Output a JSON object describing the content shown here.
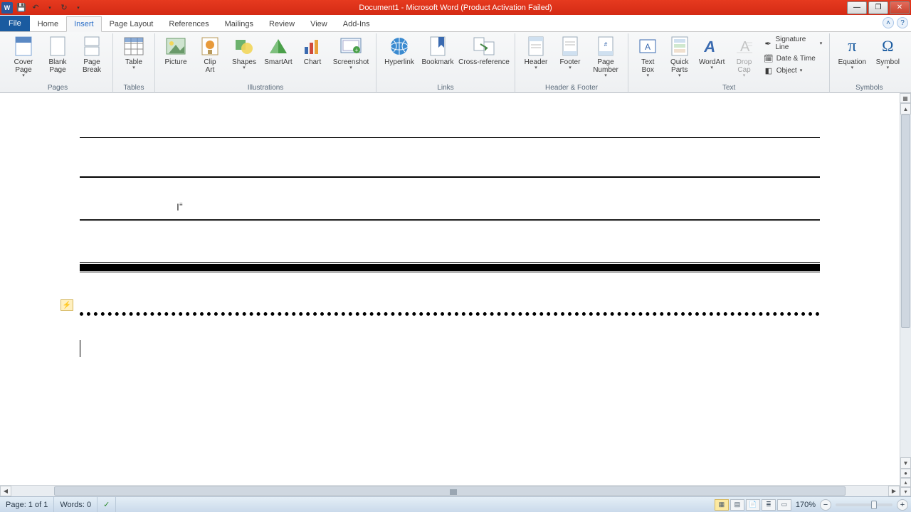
{
  "title": "Document1 - Microsoft Word (Product Activation Failed)",
  "qat": {
    "save": "💾",
    "undo": "↶",
    "redo": "↻",
    "customize": "▾"
  },
  "tabs": [
    "File",
    "Home",
    "Insert",
    "Page Layout",
    "References",
    "Mailings",
    "Review",
    "View",
    "Add-Ins"
  ],
  "active_tab": "Insert",
  "ribbon_help": {
    "minimize": "˄",
    "help": "?"
  },
  "ribbon": {
    "pages": {
      "label": "Pages",
      "cover": "Cover\nPage",
      "cover_drop": "▾",
      "blank": "Blank\nPage",
      "break": "Page\nBreak"
    },
    "tables": {
      "label": "Tables",
      "table": "Table",
      "table_drop": "▾"
    },
    "illustrations": {
      "label": "Illustrations",
      "picture": "Picture",
      "clipart": "Clip\nArt",
      "shapes": "Shapes",
      "shapes_drop": "▾",
      "smartart": "SmartArt",
      "chart": "Chart",
      "screenshot": "Screenshot",
      "screenshot_drop": "▾"
    },
    "links": {
      "label": "Links",
      "hyperlink": "Hyperlink",
      "bookmark": "Bookmark",
      "crossref": "Cross-reference"
    },
    "headerfooter": {
      "label": "Header & Footer",
      "header": "Header",
      "header_drop": "▾",
      "footer": "Footer",
      "footer_drop": "▾",
      "pagenum": "Page\nNumber",
      "pagenum_drop": "▾"
    },
    "text": {
      "label": "Text",
      "textbox": "Text\nBox",
      "textbox_drop": "▾",
      "quickparts": "Quick\nParts",
      "quickparts_drop": "▾",
      "wordart": "WordArt",
      "wordart_drop": "▾",
      "dropcap": "Drop\nCap",
      "dropcap_drop": "▾",
      "sigline": "Signature Line",
      "sigline_drop": "▾",
      "datetime": "Date & Time",
      "object": "Object",
      "object_drop": "▾"
    },
    "symbols": {
      "label": "Symbols",
      "equation": "Equation",
      "equation_drop": "▾",
      "symbol": "Symbol",
      "symbol_drop": "▾"
    }
  },
  "status": {
    "page": "Page: 1 of 1",
    "words": "Words: 0",
    "proof_icon": "✓",
    "zoom": "170%",
    "zoom_minus": "−",
    "zoom_plus": "+"
  },
  "view_modes": [
    "▦",
    "▤",
    "📄",
    "≣",
    "▭"
  ],
  "doc": {
    "autofmt_icon": "⚡",
    "ibeam": "I"
  }
}
